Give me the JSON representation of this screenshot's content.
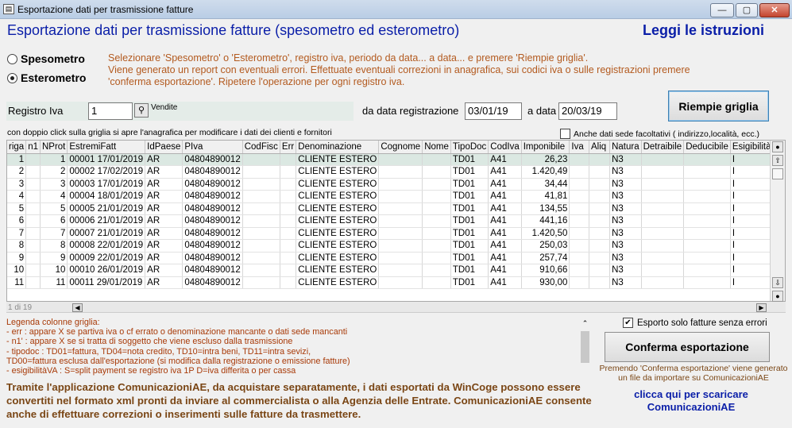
{
  "window": {
    "title": "Esportazione dati per trasmissione fatture"
  },
  "header": {
    "title": "Esportazione dati per trasmissione fatture (spesometro ed esterometro)",
    "help_link": "Leggi le istruzioni"
  },
  "mode": {
    "options": [
      "Spesometro",
      "Esterometro"
    ],
    "selected": "Esterometro"
  },
  "instructions": [
    "Selezionare 'Spesometro' o 'Esterometro', registro iva, periodo da data... a data... e premere 'Riempie griglia'.",
    "Viene generato un report con eventuali errori. Effettuate eventuali correzioni in anagrafica, sui codici iva o sulle registrazioni premere",
    "'conferma esportazione'. Ripetere l'operazione per ogni registro iva."
  ],
  "registro": {
    "label": "Registro Iva",
    "value": "1",
    "description": "Vendite"
  },
  "date_range": {
    "from_label": "da data registrazione",
    "from_value": "03/01/19",
    "to_label": "a data",
    "to_value": "20/03/19"
  },
  "fill_button": "Riempie griglia",
  "grid_hint": "con doppio click sulla griglia si apre l'anagrafica per modificare i dati dei clienti e fornitori",
  "optional_checkbox": {
    "label": "Anche dati sede facoltativi ( indirizzo,località, ecc.)",
    "checked": false
  },
  "grid": {
    "columns": [
      "riga",
      "n1",
      "NProt",
      "EstremiFatt",
      "IdPaese",
      "PIva",
      "CodFisc",
      "Err",
      "Denominazione",
      "Cognome",
      "Nome",
      "TipoDoc",
      "CodIva",
      "Imponibile",
      "Iva",
      "Aliq",
      "Natura",
      "Detraibile",
      "Deducibile",
      "EsigibilitàVA"
    ],
    "rows": [
      [
        "1",
        "",
        "1",
        "00001 17/01/2019",
        "AR",
        "04804890012",
        "",
        "",
        "CLIENTE ESTERO",
        "",
        "",
        "TD01",
        "A41",
        "26,23",
        "",
        "",
        "N3",
        "",
        "",
        "I"
      ],
      [
        "2",
        "",
        "2",
        "00002 17/02/2019",
        "AR",
        "04804890012",
        "",
        "",
        "CLIENTE ESTERO",
        "",
        "",
        "TD01",
        "A41",
        "1.420,49",
        "",
        "",
        "N3",
        "",
        "",
        "I"
      ],
      [
        "3",
        "",
        "3",
        "00003 17/01/2019",
        "AR",
        "04804890012",
        "",
        "",
        "CLIENTE ESTERO",
        "",
        "",
        "TD01",
        "A41",
        "34,44",
        "",
        "",
        "N3",
        "",
        "",
        "I"
      ],
      [
        "4",
        "",
        "4",
        "00004 18/01/2019",
        "AR",
        "04804890012",
        "",
        "",
        "CLIENTE ESTERO",
        "",
        "",
        "TD01",
        "A41",
        "41,81",
        "",
        "",
        "N3",
        "",
        "",
        "I"
      ],
      [
        "5",
        "",
        "5",
        "00005 21/01/2019",
        "AR",
        "04804890012",
        "",
        "",
        "CLIENTE ESTERO",
        "",
        "",
        "TD01",
        "A41",
        "134,55",
        "",
        "",
        "N3",
        "",
        "",
        "I"
      ],
      [
        "6",
        "",
        "6",
        "00006 21/01/2019",
        "AR",
        "04804890012",
        "",
        "",
        "CLIENTE ESTERO",
        "",
        "",
        "TD01",
        "A41",
        "441,16",
        "",
        "",
        "N3",
        "",
        "",
        "I"
      ],
      [
        "7",
        "",
        "7",
        "00007 21/01/2019",
        "AR",
        "04804890012",
        "",
        "",
        "CLIENTE ESTERO",
        "",
        "",
        "TD01",
        "A41",
        "1.420,50",
        "",
        "",
        "N3",
        "",
        "",
        "I"
      ],
      [
        "8",
        "",
        "8",
        "00008 22/01/2019",
        "AR",
        "04804890012",
        "",
        "",
        "CLIENTE ESTERO",
        "",
        "",
        "TD01",
        "A41",
        "250,03",
        "",
        "",
        "N3",
        "",
        "",
        "I"
      ],
      [
        "9",
        "",
        "9",
        "00009 22/01/2019",
        "AR",
        "04804890012",
        "",
        "",
        "CLIENTE ESTERO",
        "",
        "",
        "TD01",
        "A41",
        "257,74",
        "",
        "",
        "N3",
        "",
        "",
        "I"
      ],
      [
        "10",
        "",
        "10",
        "00010 26/01/2019",
        "AR",
        "04804890012",
        "",
        "",
        "CLIENTE ESTERO",
        "",
        "",
        "TD01",
        "A41",
        "910,66",
        "",
        "",
        "N3",
        "",
        "",
        "I"
      ],
      [
        "11",
        "",
        "11",
        "00011 29/01/2019",
        "AR",
        "04804890012",
        "",
        "",
        "CLIENTE ESTERO",
        "",
        "",
        "TD01",
        "A41",
        "930,00",
        "",
        "",
        "N3",
        "",
        "",
        "I"
      ]
    ],
    "page_count": "1 di 19"
  },
  "legend": [
    "Legenda colonne griglia:",
    "- err  : appare X se partiva iva o cf errato o denominazione mancante o dati sede mancanti",
    "- n1'  : appare X se si tratta di soggetto che viene escluso dalla trasmissione",
    "- tipodoc : TD01=fattura, TD04=nota credito, TD10=intra beni, TD11=intra sevizi,",
    "   TD00=fattura esclusa dall'esportazione (si modifica dalla registrazione o emissione fatture)",
    "- esigibilitàVA :  S=split payment se registro iva 1P  D=iva differita o per cassa"
  ],
  "promo": "Tramite l'applicazione  ComunicazioniAE, da acquistare separatamente, i dati esportati da WinCoge possono essere convertiti nel formato xml pronti da inviare al commercialista o alla Agenzia delle Entrate. ComunicazioniAE consente anche di effettuare correzioni o inserimenti sulle fatture da trasmettere.",
  "export_checkbox": {
    "label": "Esporto solo fatture senza errori",
    "checked": true
  },
  "confirm_button": "Conferma esportazione",
  "confirm_note": "Premendo 'Conferma esportazione' viene generato un file da importare su ComunicazioniAE",
  "download_link": "clicca qui per scaricare ComunicazioniAE"
}
